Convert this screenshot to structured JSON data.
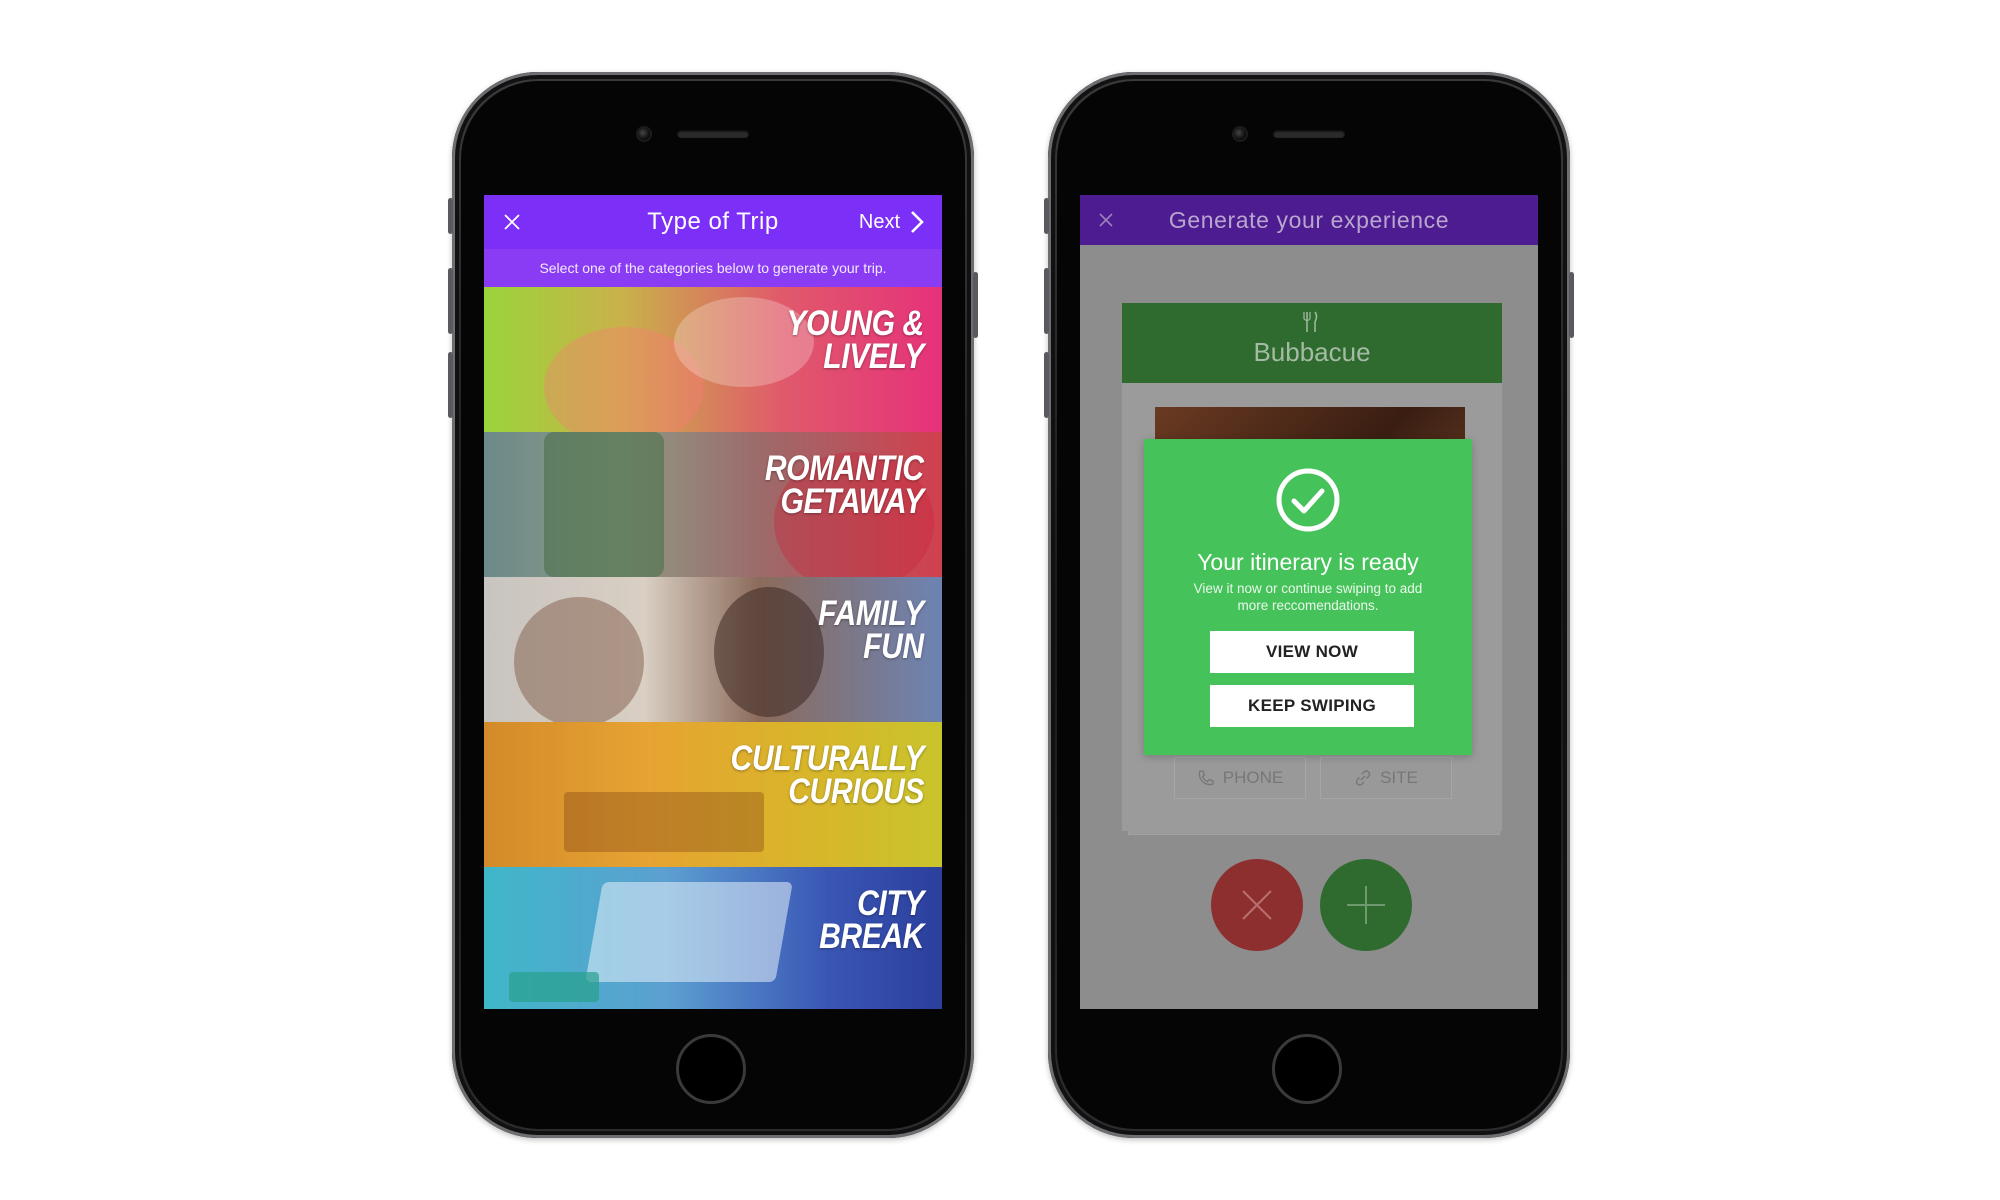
{
  "left_screen": {
    "title": "Type of Trip",
    "next_label": "Next",
    "subtitle": "Select one of the categories below to generate your trip.",
    "accent": "#7b2ff7",
    "categories": [
      {
        "line1": "YOUNG &",
        "line2": "LIVELY"
      },
      {
        "line1": "ROMANTIC",
        "line2": "GETAWAY"
      },
      {
        "line1": "FAMILY",
        "line2": "FUN"
      },
      {
        "line1": "CULTURALLY",
        "line2": "CURIOUS"
      },
      {
        "line1": "CITY",
        "line2": "BREAK"
      }
    ]
  },
  "right_screen": {
    "title": "Generate your experience",
    "venue_name": "Bubbacue",
    "venue_icon": "fork-knife-icon",
    "actions": {
      "phone": "PHONE",
      "site": "SITE"
    },
    "modal": {
      "heading": "Your itinerary is ready",
      "subtext": "View it now or continue swiping to add more reccomendations.",
      "view_now": "VIEW NOW",
      "keep_swiping": "KEEP SWIPING",
      "color": "#45c259"
    }
  }
}
